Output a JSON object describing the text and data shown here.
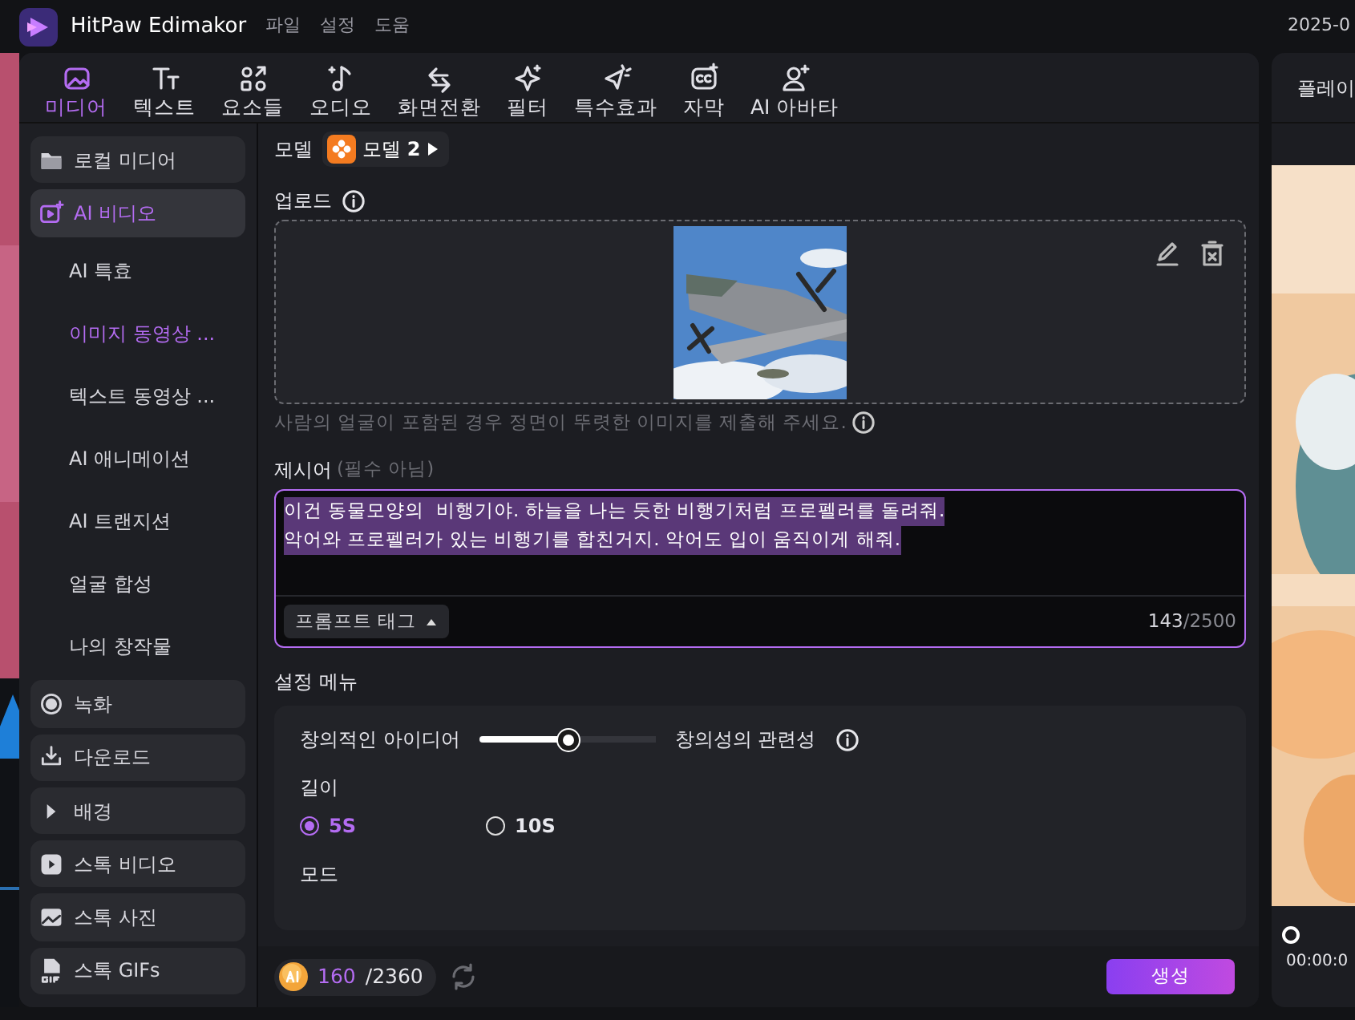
{
  "title_bar": {
    "app_name": "HitPaw Edimakor",
    "menus": [
      "파일",
      "설정",
      "도움"
    ],
    "date": "2025-0"
  },
  "toolbar": [
    {
      "label": "미디어",
      "selected": true
    },
    {
      "label": "텍스트",
      "selected": false
    },
    {
      "label": "요소들",
      "selected": false
    },
    {
      "label": "오디오",
      "selected": false
    },
    {
      "label": "화면전환",
      "selected": false
    },
    {
      "label": "필터",
      "selected": false
    },
    {
      "label": "특수효과",
      "selected": false
    },
    {
      "label": "자막",
      "selected": false
    },
    {
      "label": "AI 아바타",
      "selected": false
    }
  ],
  "sidebar": [
    {
      "label": "로컬 미디어",
      "selected": false
    },
    {
      "label": "AI 비디오",
      "selected": true,
      "children": [
        {
          "label": "AI 특효",
          "selected": false
        },
        {
          "label": "이미지 동영상 ...",
          "selected": true
        },
        {
          "label": "텍스트 동영상 ...",
          "selected": false
        },
        {
          "label": "AI 애니메이션",
          "selected": false
        },
        {
          "label": "AI 트랜지션",
          "selected": false
        },
        {
          "label": "얼굴 합성",
          "selected": false
        },
        {
          "label": "나의 창작물",
          "selected": false
        }
      ]
    },
    {
      "label": "녹화",
      "selected": false
    },
    {
      "label": "다운로드",
      "selected": false
    },
    {
      "label": "배경",
      "selected": false
    },
    {
      "label": "스톡 비디오",
      "selected": false
    },
    {
      "label": "스톡 사진",
      "selected": false
    },
    {
      "label": "스톡 GIFs",
      "selected": false
    }
  ],
  "model": {
    "label": "모델",
    "value": "모델 **2**"
  },
  "upload": {
    "label": "업로드",
    "hint": "사람의 얼굴이 포함된 경우 정면이 뚜렷한 이미지를 제출해 주세요."
  },
  "prompt": {
    "label": "제시어",
    "note": "(필수 아님)",
    "lines": [
      "이건 동물모양의  비행기야. 하늘을 나는 듯한 비행기처럼 프로펠러를 돌려줘.",
      "악어와 프로펠러가 있는 비행기를 합친거지. 악어도 입이 움직이게 해줘."
    ],
    "tag_button": "프롬프트 태그",
    "count": "143",
    "limit": "/2500"
  },
  "settings": {
    "heading": "설정 메뉴",
    "slider_left": "창의적인 아이디어",
    "slider_right": "창의성의 관련성",
    "level": 0.5,
    "length_label": "길이",
    "lengths": [
      {
        "label": "5S",
        "selected": true
      },
      {
        "label": "10S",
        "selected": false
      }
    ],
    "mode_label": "모드"
  },
  "footer": {
    "credits_used": "160",
    "credits_total": "/2360",
    "generate": "생성"
  },
  "preview": {
    "title": "플레이",
    "time": "00:00:0"
  }
}
